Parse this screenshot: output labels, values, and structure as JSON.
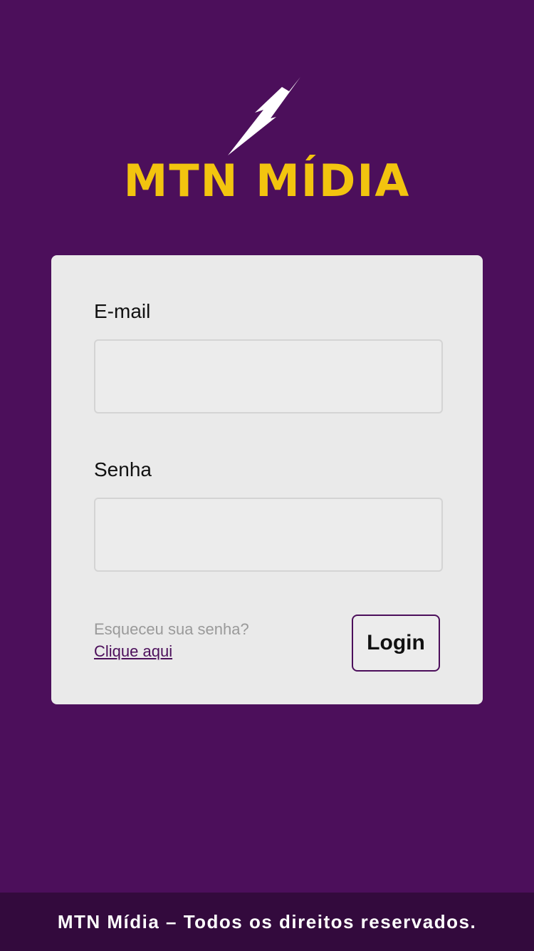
{
  "brand": {
    "name": "MTN MÍDIA",
    "logo_icon": "lightning-bolt-icon",
    "logo_color": "#f2c40f",
    "bolt_color": "#ffffff"
  },
  "form": {
    "email_label": "E-mail",
    "email_value": "",
    "senha_label": "Senha",
    "senha_value": "",
    "forgot_text": "Esqueceu sua senha?",
    "forgot_link": "Clique aqui",
    "login_label": "Login"
  },
  "footer": {
    "text": "MTN Mídia – Todos os direitos reservados."
  },
  "colors": {
    "background": "#4c0f5b",
    "card": "#eaeaea",
    "footer": "#330a3d",
    "accent": "#4c0f5b"
  }
}
